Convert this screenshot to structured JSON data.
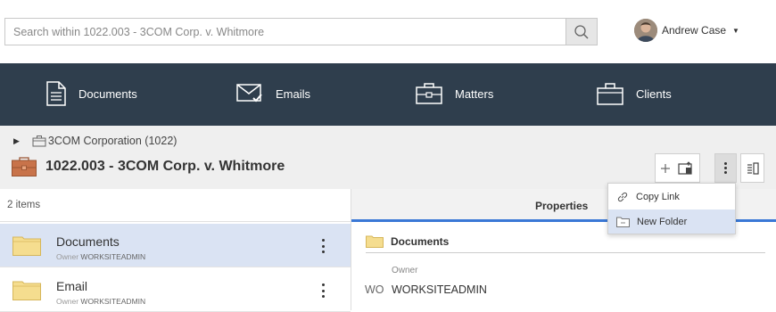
{
  "search": {
    "placeholder": "Search within 1022.003 - 3COM Corp. v. Whitmore"
  },
  "user": {
    "name": "Andrew Case"
  },
  "nav": [
    {
      "label": "Documents",
      "icon": "document-icon"
    },
    {
      "label": "Emails",
      "icon": "email-icon"
    },
    {
      "label": "Matters",
      "icon": "matter-briefcase-icon"
    },
    {
      "label": "Clients",
      "icon": "client-briefcase-icon"
    }
  ],
  "breadcrumb": {
    "parent": "3COM Corporation (1022)"
  },
  "page_title": "1022.003 - 3COM Corp. v. Whitmore",
  "list": {
    "count": "2 items",
    "owner_prefix": "Owner",
    "items": [
      {
        "name": "Documents",
        "owner": "WORKSITEADMIN"
      },
      {
        "name": "Email",
        "owner": "WORKSITEADMIN"
      }
    ]
  },
  "properties": {
    "tab": "Properties",
    "folder_name": "Documents",
    "owner_label": "Owner",
    "owner_badge": "WO",
    "owner_value": "WORKSITEADMIN"
  },
  "menu": {
    "items": [
      {
        "label": "Copy Link",
        "icon": "link-icon"
      },
      {
        "label": "New Folder",
        "icon": "new-folder-icon"
      }
    ]
  },
  "colors": {
    "nav_bg": "#2f3e4d",
    "accent": "#3a78d6",
    "selected_row": "#dae3f3",
    "folder": "#f5dd8f",
    "matter_icon": "#c8734a"
  }
}
